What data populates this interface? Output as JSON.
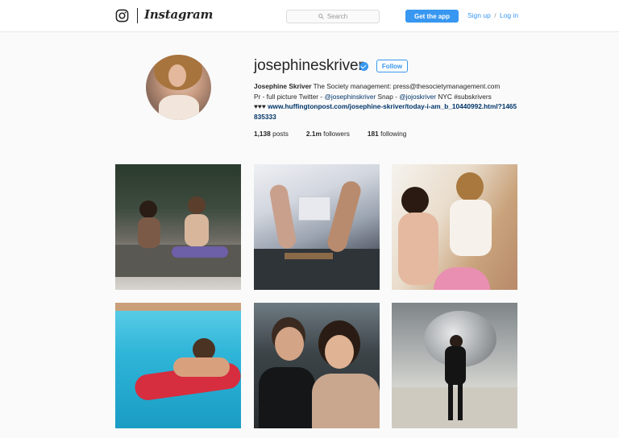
{
  "header": {
    "brand": "Instagram",
    "search_placeholder": "Search",
    "get_app": "Get the app",
    "sign_up": "Sign up",
    "separator": "/",
    "log_in": "Log in",
    "colors": {
      "accent": "#3897f0",
      "border": "#e6e6e6"
    }
  },
  "profile": {
    "username": "josephineskriver",
    "verified": true,
    "follow_label": "Follow",
    "bio": {
      "name": "Josephine Skriver",
      "line1": " The Society management: press@thesocietymanagement.com",
      "line2a": "Pr - full picture Twitter - ",
      "mention1": "@josephinskriver",
      "line2b": " Snap - ",
      "mention2": "@jojoskriver",
      "line2c": " NYC #subskrivers",
      "hearts": "♥♥♥ ",
      "link": "www.huffingtonpost.com/josephine-skriver/today-i-am_b_10440992.html?1465835333"
    },
    "stats": {
      "posts_count": "1,138",
      "posts_label": "posts",
      "followers_count": "2.1m",
      "followers_label": "followers",
      "following_count": "181",
      "following_label": "following"
    }
  },
  "posts": [
    {
      "id": "post-1",
      "icon": "photo"
    },
    {
      "id": "post-2",
      "icon": "photo"
    },
    {
      "id": "post-3",
      "icon": "photo"
    },
    {
      "id": "post-4",
      "icon": "photo"
    },
    {
      "id": "post-5",
      "icon": "photo"
    },
    {
      "id": "post-6",
      "icon": "photo"
    }
  ]
}
